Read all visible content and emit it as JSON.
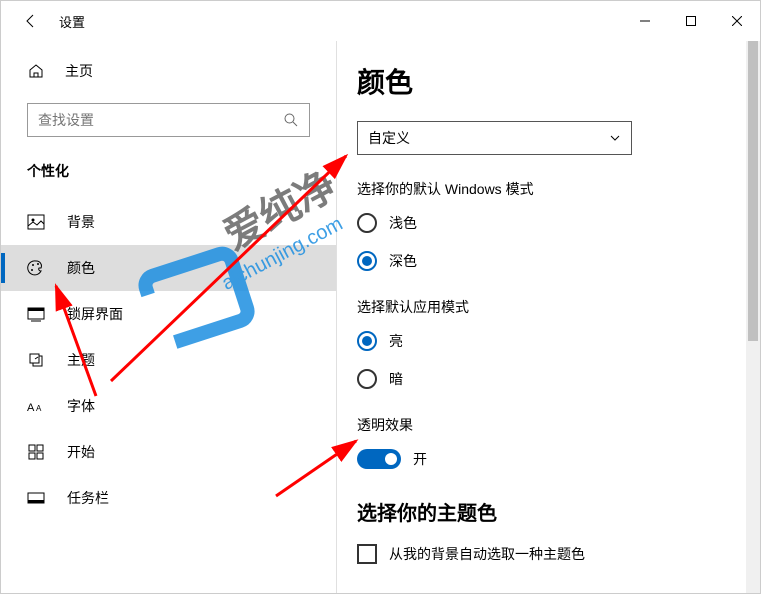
{
  "window": {
    "title": "设置"
  },
  "sidebar": {
    "home": "主页",
    "search_placeholder": "查找设置",
    "category": "个性化",
    "items": [
      {
        "label": "背景",
        "icon": "image-icon"
      },
      {
        "label": "颜色",
        "icon": "palette-icon"
      },
      {
        "label": "锁屏界面",
        "icon": "lock-screen-icon"
      },
      {
        "label": "主题",
        "icon": "theme-icon"
      },
      {
        "label": "字体",
        "icon": "font-icon"
      },
      {
        "label": "开始",
        "icon": "start-icon"
      },
      {
        "label": "任务栏",
        "icon": "taskbar-icon"
      }
    ],
    "active_index": 1
  },
  "content": {
    "page_title": "颜色",
    "dropdown_value": "自定义",
    "windows_mode": {
      "label": "选择你的默认 Windows 模式",
      "options": [
        "浅色",
        "深色"
      ],
      "selected": 1
    },
    "app_mode": {
      "label": "选择默认应用模式",
      "options": [
        "亮",
        "暗"
      ],
      "selected": 0
    },
    "transparency": {
      "label": "透明效果",
      "state_label": "开",
      "on": true
    },
    "accent": {
      "heading": "选择你的主题色",
      "auto_checkbox": "从我的背景自动选取一种主题色",
      "checked": false
    }
  },
  "watermark": {
    "text": "爱纯净",
    "url": "aichunjing.com"
  }
}
